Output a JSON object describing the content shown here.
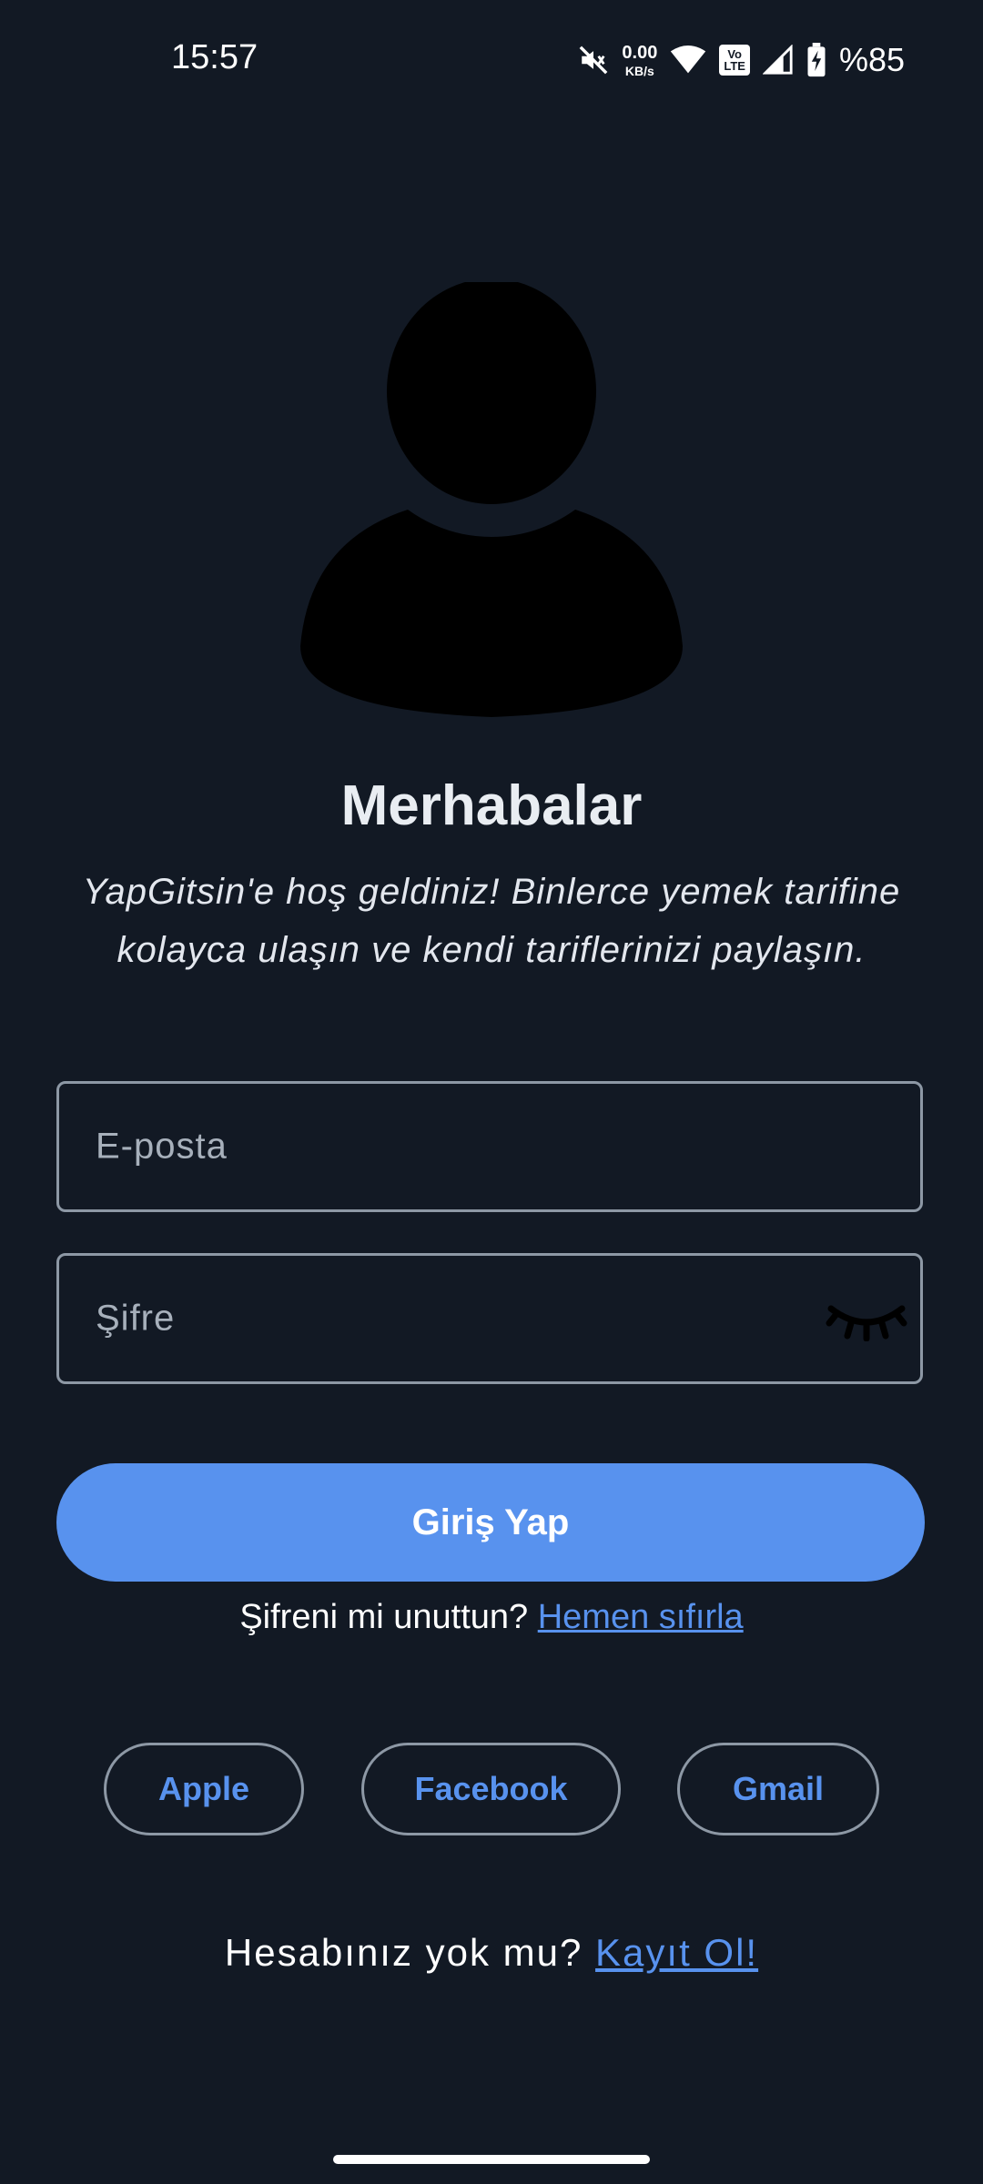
{
  "status_bar": {
    "time": "15:57",
    "net_speed_value": "0.00",
    "net_speed_unit": "KB/s",
    "volte_line1": "Vo",
    "volte_line2": "LTE",
    "battery": "%85"
  },
  "welcome": {
    "title": "Merhabalar",
    "subtitle": "YapGitsin'e hoş geldiniz! Binlerce yemek tarifine kolayca ulaşın ve kendi tariflerinizi paylaşın."
  },
  "form": {
    "email_placeholder": "E-posta",
    "password_placeholder": "Şifre",
    "login_label": "Giriş Yap",
    "forgot_text": "Şifreni mi unuttun? ",
    "forgot_link": "Hemen sıfırla"
  },
  "social": {
    "apple": "Apple",
    "facebook": "Facebook",
    "gmail": "Gmail"
  },
  "signup": {
    "text": "Hesabınız yok mu? ",
    "link": "Kayıt Ol!"
  },
  "colors": {
    "background": "#121924",
    "accent": "#5892ee",
    "border": "#8d98a5"
  },
  "icons": {
    "mute": "vibrate-off-icon",
    "wifi": "wifi-icon",
    "signal": "cell-signal-icon",
    "battery": "battery-charging-icon",
    "avatar": "user-avatar-icon",
    "password_toggle": "eye-closed-icon"
  }
}
